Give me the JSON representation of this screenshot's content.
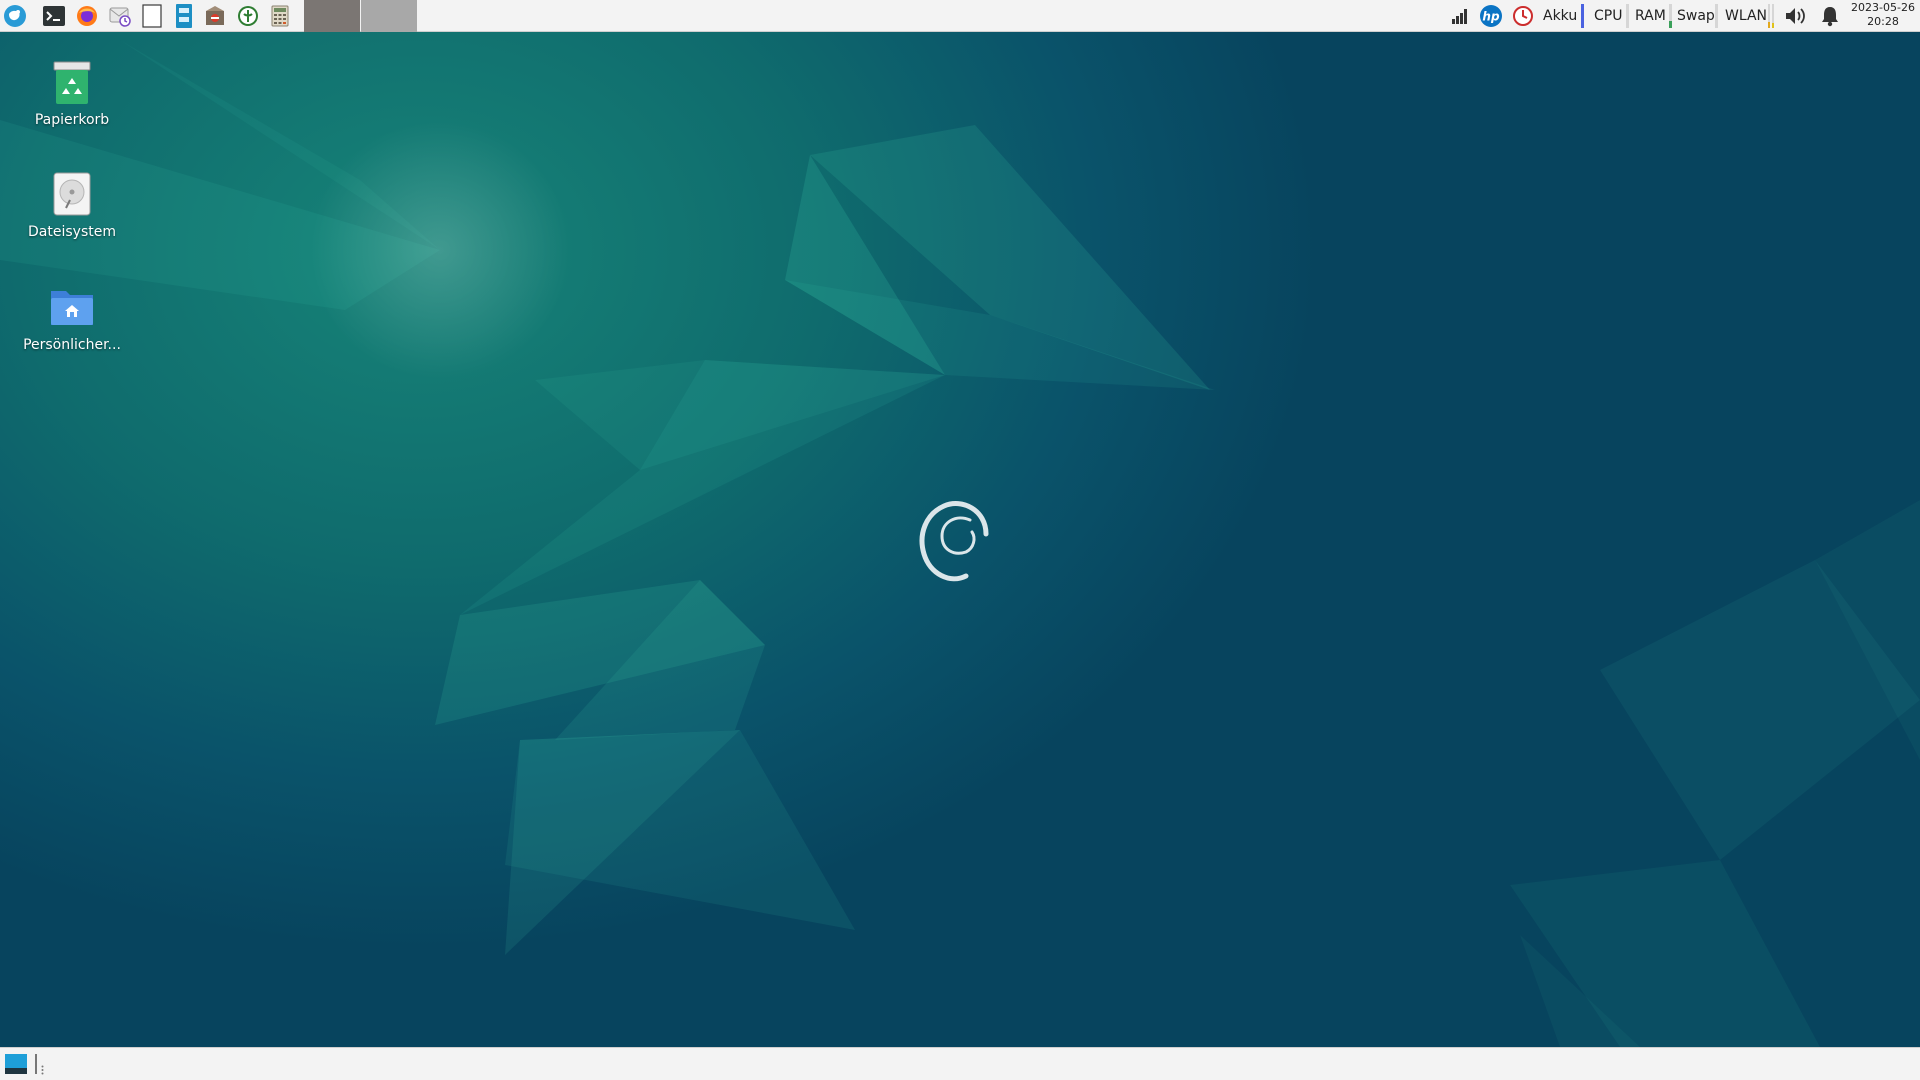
{
  "top_panel": {
    "launchers": [
      {
        "name": "whisker-menu-icon"
      },
      {
        "name": "terminal-icon"
      },
      {
        "name": "firefox-icon"
      },
      {
        "name": "mail-reader-icon"
      },
      {
        "name": "text-editor-icon"
      },
      {
        "name": "file-manager-icon"
      },
      {
        "name": "package-manager-icon"
      },
      {
        "name": "app-finder-icon"
      },
      {
        "name": "calculator-icon"
      }
    ],
    "tray": {
      "battery_label": "Akku",
      "cpu_label": "CPU",
      "ram_label": "RAM",
      "swap_label": "Swap",
      "wlan_label": "WLAN"
    },
    "clock": {
      "date": "2023-05-26",
      "time": "20:28"
    }
  },
  "desktop": {
    "icons": [
      {
        "label": "Papierkorb",
        "icon": "trash-icon"
      },
      {
        "label": "Dateisystem",
        "icon": "filesystem-icon"
      },
      {
        "label": "Persönlicher...",
        "icon": "home-folder-icon"
      }
    ]
  },
  "colors": {
    "panel": "#f3f3f3",
    "wallpaper_dark": "#07445e",
    "wallpaper_teal": "#178478",
    "accent_blue": "#2a9bd6"
  }
}
